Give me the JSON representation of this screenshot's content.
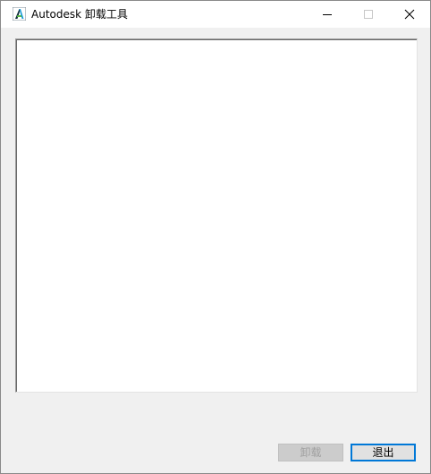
{
  "window": {
    "title": "Autodesk 卸载工具",
    "icon": "autodesk-logo-icon"
  },
  "title_bar_controls": {
    "minimize_icon": "minimize-icon",
    "maximize_icon": "maximize-icon",
    "close_icon": "close-icon",
    "maximize_enabled": false
  },
  "main": {
    "product_list_items": []
  },
  "buttons": {
    "uninstall_label": "卸载",
    "uninstall_enabled": false,
    "exit_label": "退出",
    "exit_enabled": true
  },
  "colors": {
    "accent": "#0078d7",
    "dialog_background": "#f0f0f0",
    "disabled_text": "#a0a0a0"
  }
}
